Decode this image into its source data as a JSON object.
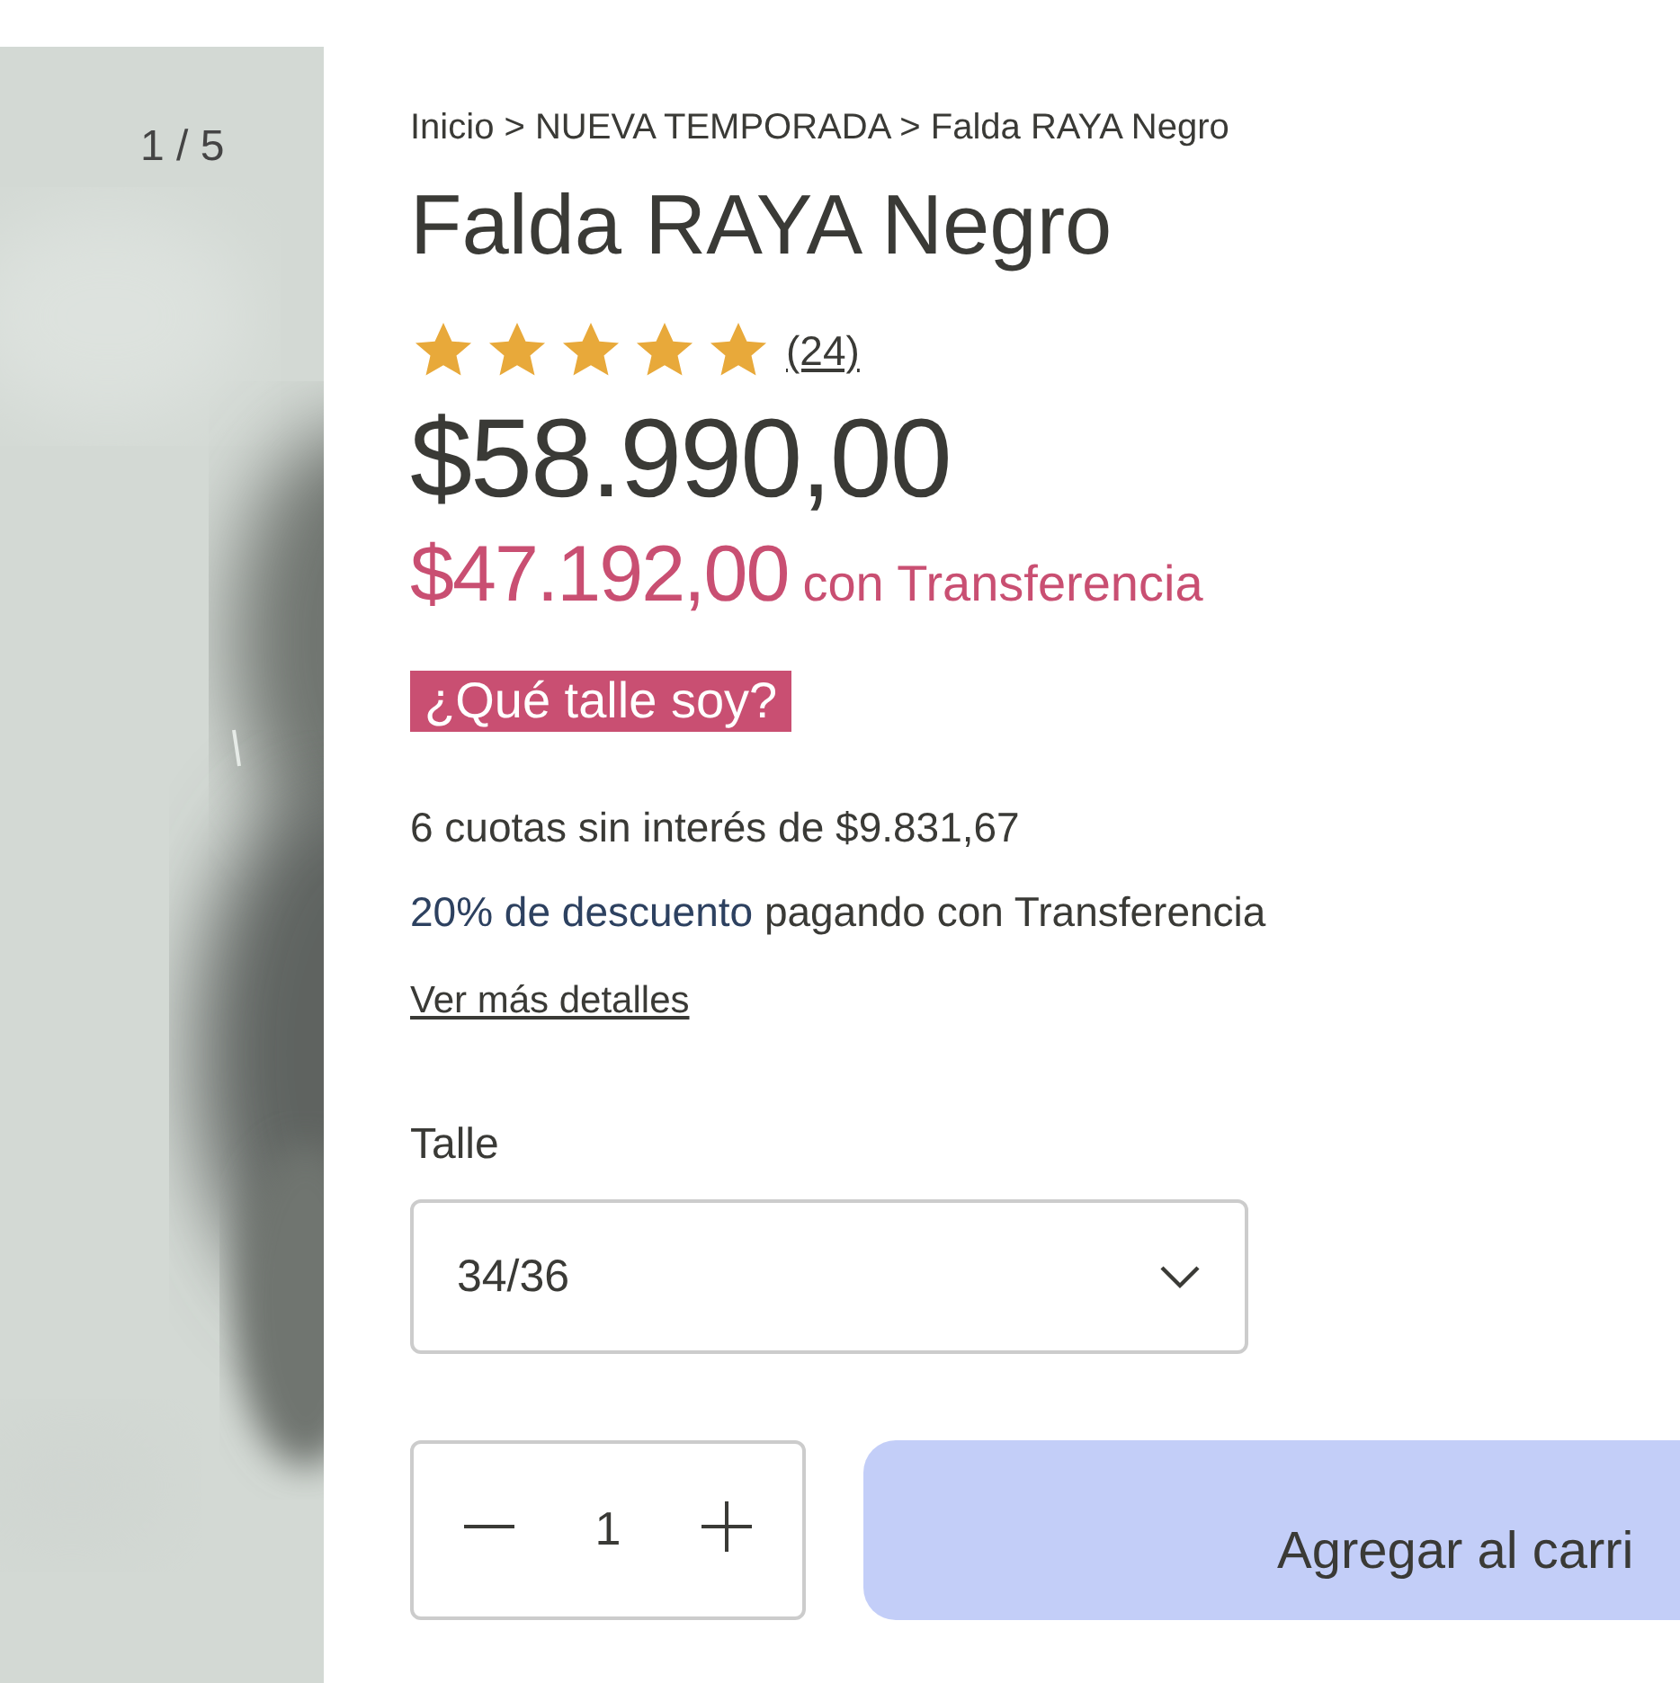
{
  "gallery": {
    "counter": "1 / 5"
  },
  "breadcrumb": "Inicio > NUEVA TEMPORADA > Falda RAYA Negro",
  "title": "Falda RAYA Negro",
  "rating": {
    "stars": 5,
    "count": "(24)"
  },
  "price": "$58.990,00",
  "transfer_price": {
    "amount": "$47.192,00",
    "label": "con Transferencia"
  },
  "size_guide": "¿Qué talle soy?",
  "installments": "6 cuotas sin interés de $9.831,67",
  "discount": {
    "highlight": "20% de descuento",
    "rest": "pagando con Transferencia"
  },
  "details_link": "Ver más detalles",
  "size": {
    "label": "Talle",
    "value": "34/36"
  },
  "quantity": "1",
  "add_button": "Agregar al carri"
}
